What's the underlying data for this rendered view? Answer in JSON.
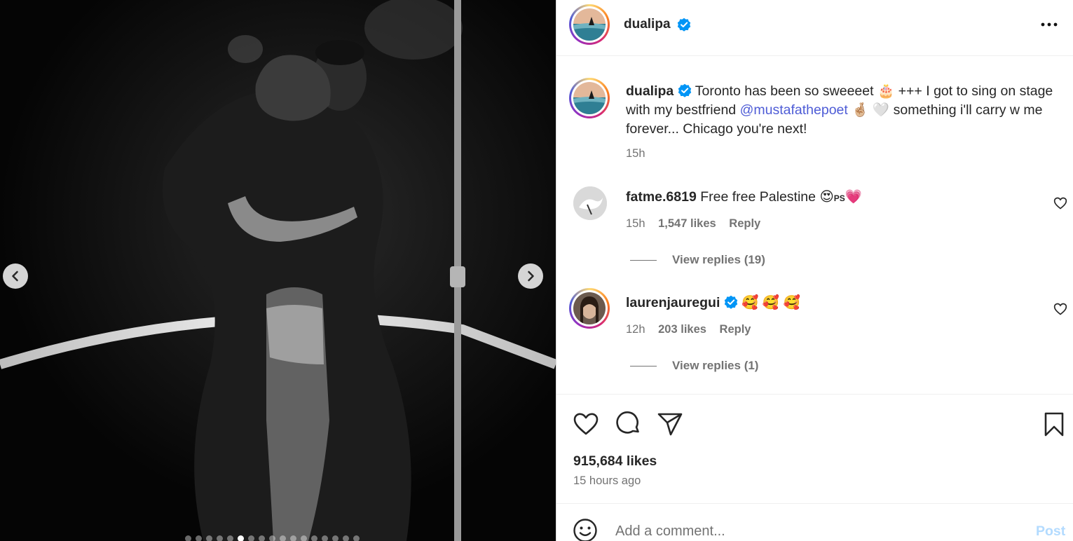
{
  "post": {
    "author": "dualipa",
    "verified": true,
    "more_icon": "more-horizontal-icon",
    "caption": {
      "text_1": "Toronto has been so sweeeet",
      "emoji_1": "🎂",
      "text_2": "+++ I got to sing on stage with my bestfriend",
      "mention": "@mustafathepoet",
      "emoji_2": "🤞🏼 🤍",
      "text_3": "something i'll carry w me forever... Chicago you're next!",
      "time": "15h"
    }
  },
  "carousel": {
    "slide_count": 17,
    "active_index": 5,
    "prev_icon": "chevron-left-icon",
    "next_icon": "chevron-right-icon"
  },
  "comments": [
    {
      "username": "fatme.6819",
      "verified": false,
      "text": "Free free Palestine",
      "emoji": "😍",
      "suffix": "PS",
      "emoji_end": "💗",
      "time": "15h",
      "likes": "1,547 likes",
      "reply": "Reply",
      "view_replies": "View replies (19)"
    },
    {
      "username": "laurenjauregui",
      "verified": true,
      "emoji": "🥰 🥰 🥰",
      "time": "12h",
      "likes": "203 likes",
      "reply": "Reply",
      "view_replies": "View replies (1)"
    }
  ],
  "actions": {
    "like_icon": "heart-icon",
    "comment_icon": "comment-icon",
    "share_icon": "send-icon",
    "save_icon": "bookmark-icon"
  },
  "stats": {
    "likes": "915,684 likes",
    "posted": "15 hours ago"
  },
  "composer": {
    "placeholder": "Add a comment...",
    "post_label": "Post"
  },
  "colors": {
    "verified": "#0095f6",
    "mention": "#4e5cd6",
    "muted": "#737373",
    "post_disabled": "#b3dbff"
  }
}
